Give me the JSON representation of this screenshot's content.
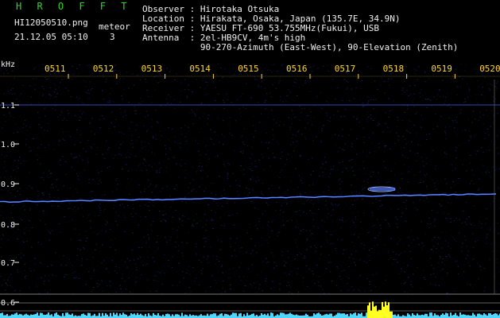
{
  "header": {
    "title": "H R O F F T",
    "file_name": "HI12050510.png",
    "meteor_label": "meteor",
    "datetime": "21.12.05 05:10",
    "meteor_count": "3",
    "info_lines": [
      "Observer : Hirotaka Otsuka",
      "Location : Hirakata, Osaka, Japan (135.7E, 34.9N)",
      "Receiver : YAESU FT-690 53.755MHz(Fukui), USB",
      "Antenna  : 2el-HB9CV, 4m's high",
      "           90-270-Azimuth (East-West), 90-Elevation (Zenith)"
    ]
  },
  "time_labels": [
    "0511",
    "0512",
    "0513",
    "0514",
    "0515",
    "0516",
    "0517",
    "0518",
    "0519",
    "0520)"
  ],
  "freq_axis": {
    "unit": "kHz",
    "labels": [
      "1.1",
      "1.0",
      "0.9",
      "0.8",
      "0.7",
      "0.6"
    ]
  },
  "colors": {
    "background": "#000000",
    "noise": "#1b2a7a",
    "trace": "#3f70ff",
    "title_green": "#2fd52f",
    "tick_yellow": "#ffd52a",
    "level_cyan": "#4fd8ff",
    "meteor_bar": "#ffff22"
  }
}
